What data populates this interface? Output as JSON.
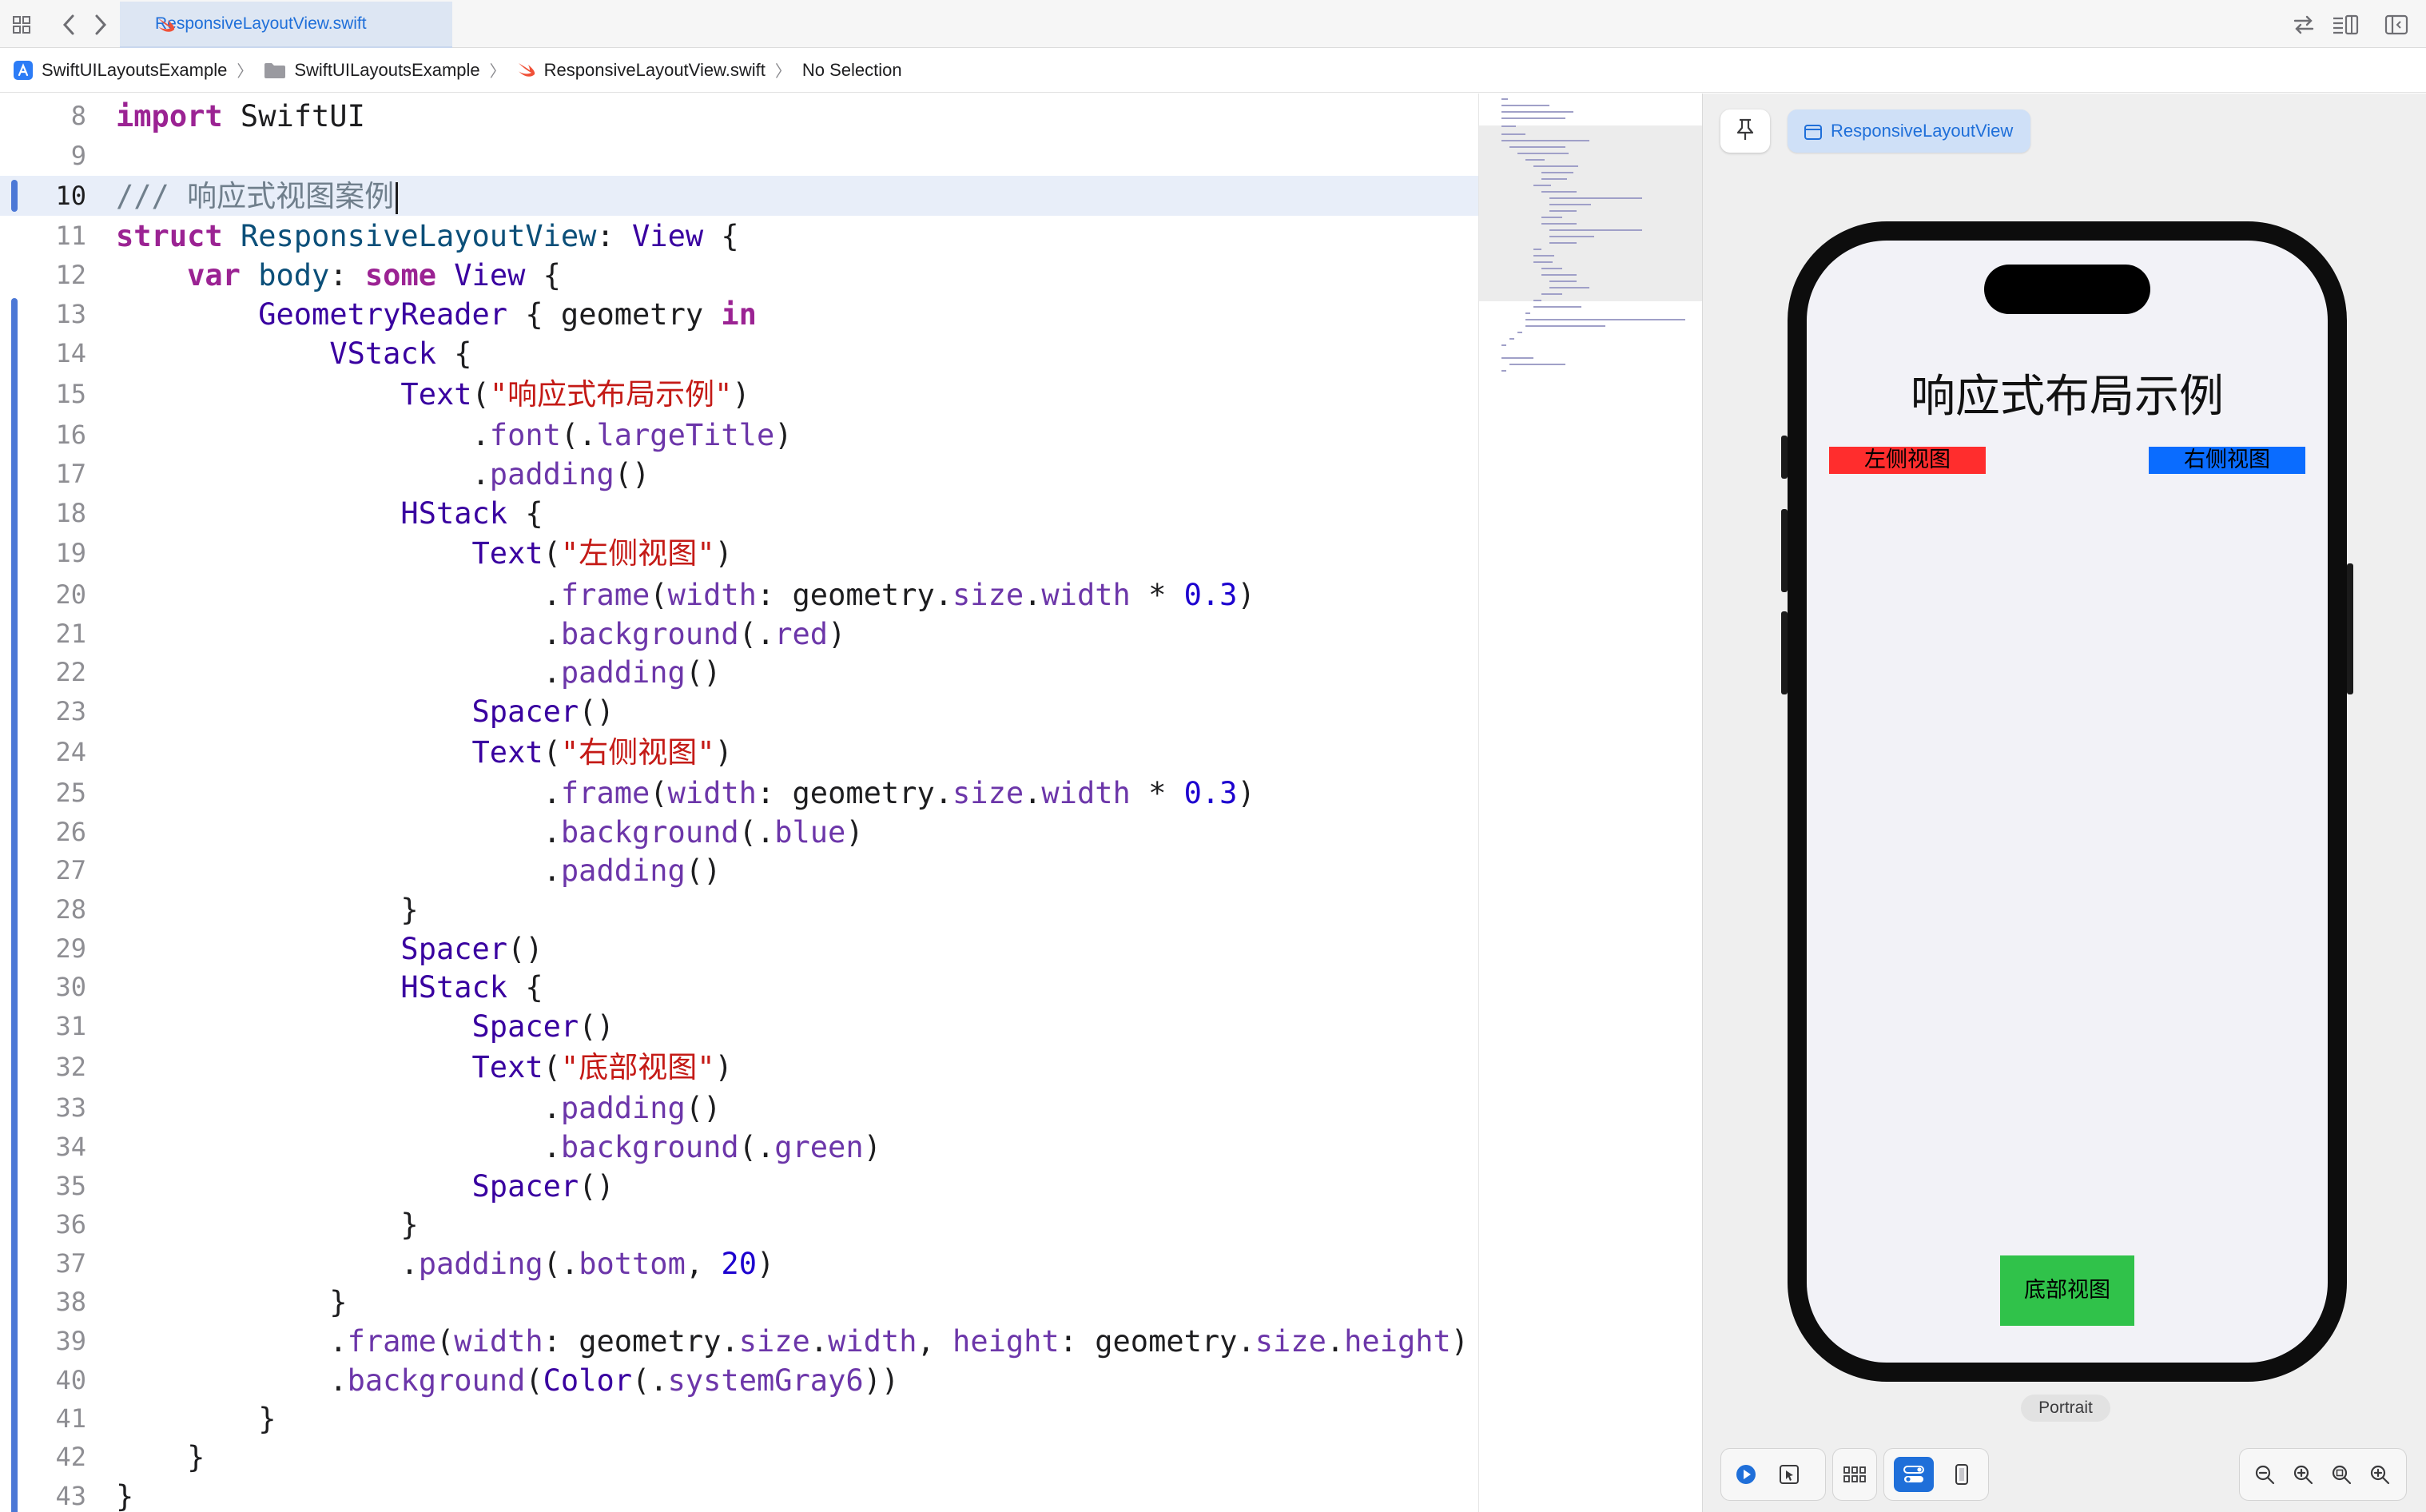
{
  "tab": {
    "filename": "ResponsiveLayoutView.swift"
  },
  "breadcrumb": {
    "project": "SwiftUILayoutsExample",
    "folder": "SwiftUILayoutsExample",
    "file": "ResponsiveLayoutView.swift",
    "selection": "No Selection"
  },
  "editor": {
    "current_line": 10,
    "line_numbers": [
      "8",
      "9",
      "10",
      "11",
      "12",
      "13",
      "14",
      "15",
      "16",
      "17",
      "18",
      "19",
      "20",
      "21",
      "22",
      "23",
      "24",
      "25",
      "26",
      "27",
      "28",
      "29",
      "30",
      "31",
      "32",
      "33",
      "34",
      "35",
      "36",
      "37",
      "38",
      "39",
      "40",
      "41",
      "42",
      "43"
    ]
  },
  "preview": {
    "chip_label": "ResponsiveLayoutView",
    "app_title": "响应式布局示例",
    "left_view": "左侧视图",
    "right_view": "右侧视图",
    "bottom_view": "底部视图",
    "orientation_label": "Portrait"
  },
  "colors": {
    "accent": "#1f6fd9",
    "left_view_bg": "#ff2d2d",
    "right_view_bg": "#0a6cff",
    "bottom_view_bg": "#30c24a",
    "keyword": "#9b2393",
    "string": "#c41a16",
    "number": "#1c00cf"
  },
  "icons": {
    "tabbar": [
      "grid-icon",
      "back-icon",
      "forward-icon",
      "swap-icon",
      "editor-options-icon",
      "inspector-toggle-icon"
    ],
    "toolbar_left": [
      "live-preview-icon",
      "selectable-icon",
      "variants-icon",
      "canvas-settings-icon",
      "device-icon"
    ],
    "toolbar_right": [
      "zoom-out-icon",
      "zoom-in-icon",
      "zoom-fit-icon",
      "zoom-actual-icon"
    ]
  }
}
